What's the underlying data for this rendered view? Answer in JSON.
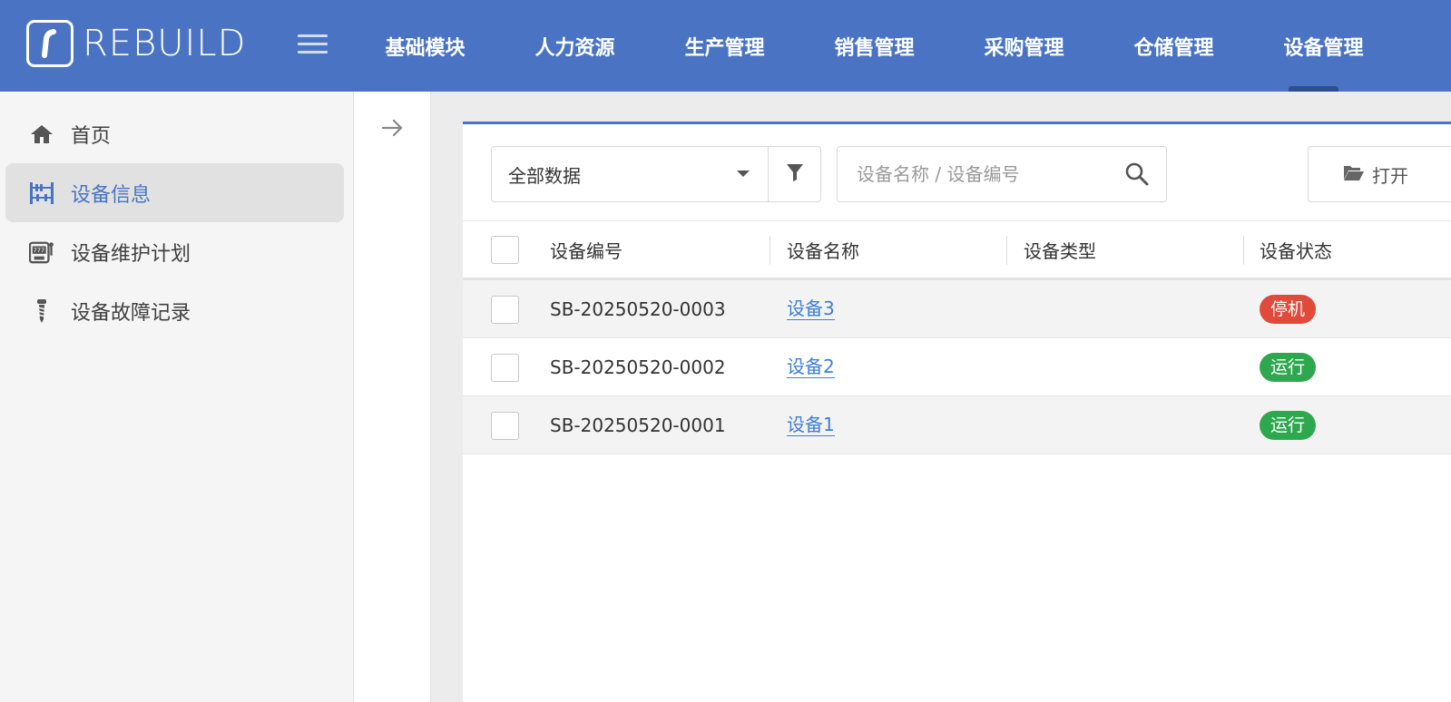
{
  "app": {
    "brand": "REBUILD"
  },
  "nav": {
    "items": [
      "基础模块",
      "人力资源",
      "生产管理",
      "销售管理",
      "采购管理",
      "仓储管理",
      "设备管理"
    ],
    "active_index": 6
  },
  "sidebar": {
    "items": [
      {
        "label": "首页",
        "icon": "home-icon"
      },
      {
        "label": "设备信息",
        "icon": "abacus-icon",
        "active": true
      },
      {
        "label": "设备维护计划",
        "icon": "slot-machine-icon"
      },
      {
        "label": "设备故障记录",
        "icon": "screw-icon"
      }
    ]
  },
  "toolbar": {
    "filter_value": "全部数据",
    "search_placeholder": "设备名称 / 设备编号",
    "open_label": "打开"
  },
  "table": {
    "columns": [
      "设备编号",
      "设备名称",
      "设备类型",
      "设备状态"
    ],
    "rows": [
      {
        "code": "SB-20250520-0003",
        "name": "设备3",
        "type": "",
        "status": "停机",
        "status_color": "#e04a3a"
      },
      {
        "code": "SB-20250520-0002",
        "name": "设备2",
        "type": "",
        "status": "运行",
        "status_color": "#2ea84f"
      },
      {
        "code": "SB-20250520-0001",
        "name": "设备1",
        "type": "",
        "status": "运行",
        "status_color": "#2ea84f"
      }
    ]
  },
  "colors": {
    "primary": "#4a74c3",
    "link": "#3f7ed8",
    "danger": "#e04a3a",
    "success": "#2ea84f"
  }
}
